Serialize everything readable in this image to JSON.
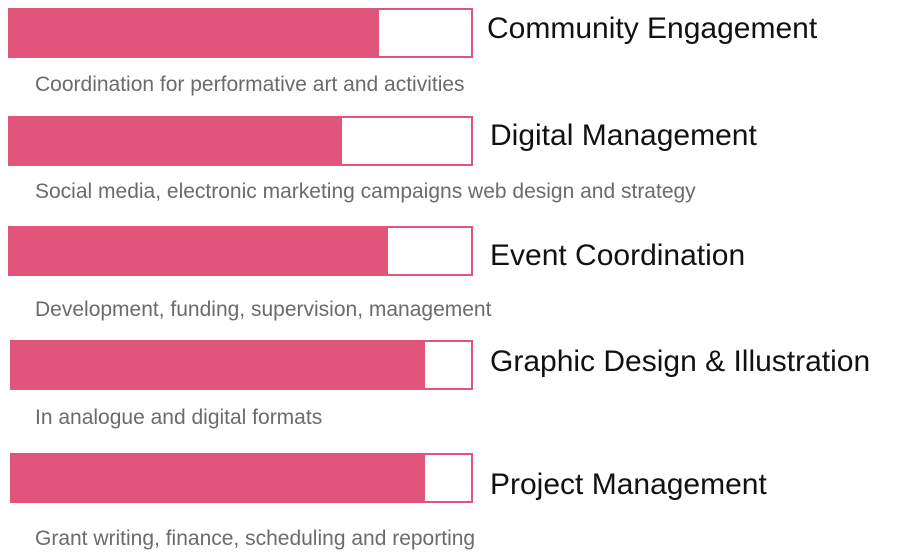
{
  "colors": {
    "bar": "#e05579",
    "title": "#111111",
    "description": "#6b6b6b"
  },
  "skills": [
    {
      "title": "Community Engagement",
      "description": "Coordination for performative art and activities",
      "level": 0.8
    },
    {
      "title": "Digital Management",
      "description": "Social media, electronic marketing campaigns web design and strategy",
      "level": 0.72
    },
    {
      "title": "Event Coordination",
      "description": "Development, funding, supervision, management",
      "level": 0.82
    },
    {
      "title": "Graphic Design & Illustration",
      "description": "In analogue and digital formats",
      "level": 0.9
    },
    {
      "title": "Project Management",
      "description": "Grant writing, finance, scheduling and reporting",
      "level": 0.9
    }
  ]
}
